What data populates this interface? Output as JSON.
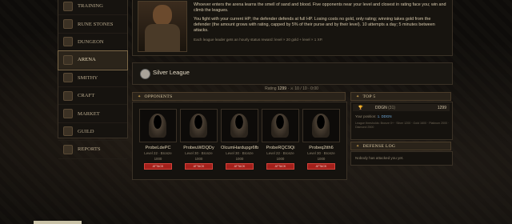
{
  "nav": {
    "items": [
      {
        "label": "Training",
        "active": false
      },
      {
        "label": "Rune Stones",
        "active": false
      },
      {
        "label": "Dungeon",
        "active": false
      },
      {
        "label": "Arena",
        "active": true
      },
      {
        "label": "Smithy",
        "active": false
      },
      {
        "label": "Craft",
        "active": false
      },
      {
        "label": "Market",
        "active": false
      },
      {
        "label": "Guild",
        "active": false
      },
      {
        "label": "Reports",
        "active": false
      }
    ]
  },
  "intro": {
    "p1": "Whoever enters the arena learns the smell of sand and blood. Five opponents near your level and closest in rating face you; win and climb the leagues.",
    "p2": "You fight with your current HP; the defender defends at full HP. Losing costs no gold, only rating; winning takes gold from the defender (the amount grows with rating, capped by 5% of their purse and by their level). 10 attempts a day; 5 minutes between attacks.",
    "p3": "Each league leader gets an hourly status reward: level × 20 gold + level × 1 XP."
  },
  "league": {
    "name": "Silver League"
  },
  "rating": {
    "label": "Rating",
    "value": "1299",
    "sep": "·",
    "attempts": "⚔ 10 / 10",
    "timer": "· 0:00"
  },
  "opponents_section": {
    "title": "Opponents"
  },
  "opponents": [
    {
      "name": "ProbeLdePC",
      "level": "Level 22 · Bronze",
      "rating": "1000",
      "button": "ATTACK"
    },
    {
      "name": "ProbeuWDQDy",
      "level": "Level 30 · Bronze",
      "rating": "1000",
      "button": "ATTACK"
    },
    {
      "name": "OlcumHardupgr6fb",
      "level": "Level 30 · Bronze",
      "rating": "1000",
      "button": "ATTACK"
    },
    {
      "name": "ProbeRQC9Qi",
      "level": "Level 22 · Bronze",
      "rating": "1000",
      "button": "ATTACK"
    },
    {
      "name": "Probeq2tth6",
      "level": "Level 30 · Bronze",
      "rating": "1000",
      "button": "ATTACK"
    }
  ],
  "top_section": {
    "title": "Top 5",
    "rows": [
      {
        "rank": "1",
        "name": "DDGN",
        "level": "(31)",
        "rating": "1299"
      }
    ],
    "your_position_label": "Your position:",
    "your_position_value": "1. DDGN",
    "thresholds": "League thresholds: Bronze 0+ · Silver 1200 · Gold 1600 · Platinum 2000 · Diamond 2500"
  },
  "defense_section": {
    "title": "Defense Log",
    "message": "Nobody has attacked you yet."
  }
}
